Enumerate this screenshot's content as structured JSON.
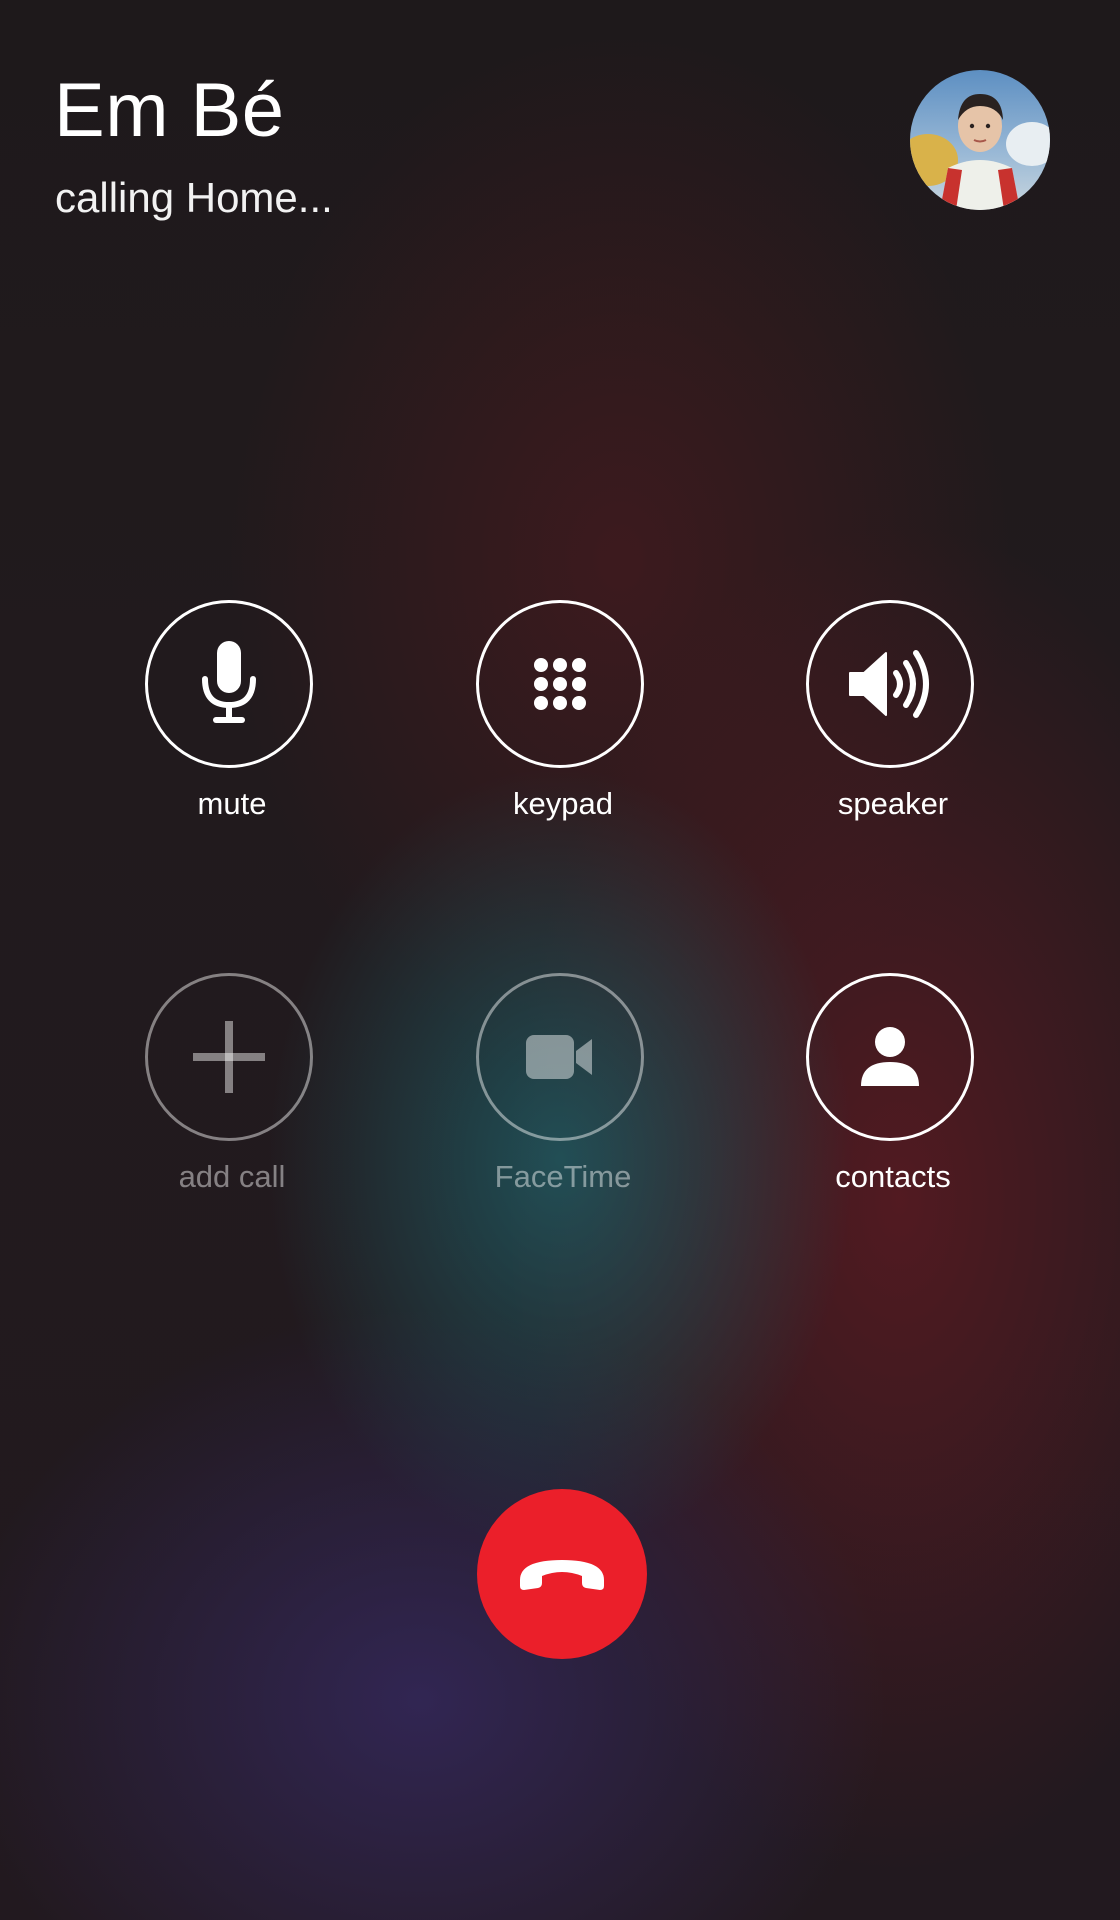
{
  "caller": {
    "name": "Em Bé",
    "status": "calling Home..."
  },
  "controls": [
    {
      "label": "mute",
      "icon": "microphone-icon",
      "enabled": true
    },
    {
      "label": "keypad",
      "icon": "keypad-icon",
      "enabled": true
    },
    {
      "label": "speaker",
      "icon": "speaker-icon",
      "enabled": true
    },
    {
      "label": "add call",
      "icon": "plus-icon",
      "enabled": false
    },
    {
      "label": "FaceTime",
      "icon": "video-camera-icon",
      "enabled": false
    },
    {
      "label": "contacts",
      "icon": "person-icon",
      "enabled": true
    }
  ],
  "end_call": {
    "icon": "phone-hangup-icon",
    "color": "#eb1f2a"
  },
  "colors": {
    "text": "#ffffff",
    "disabled": "rgba(255,255,255,0.45)"
  }
}
